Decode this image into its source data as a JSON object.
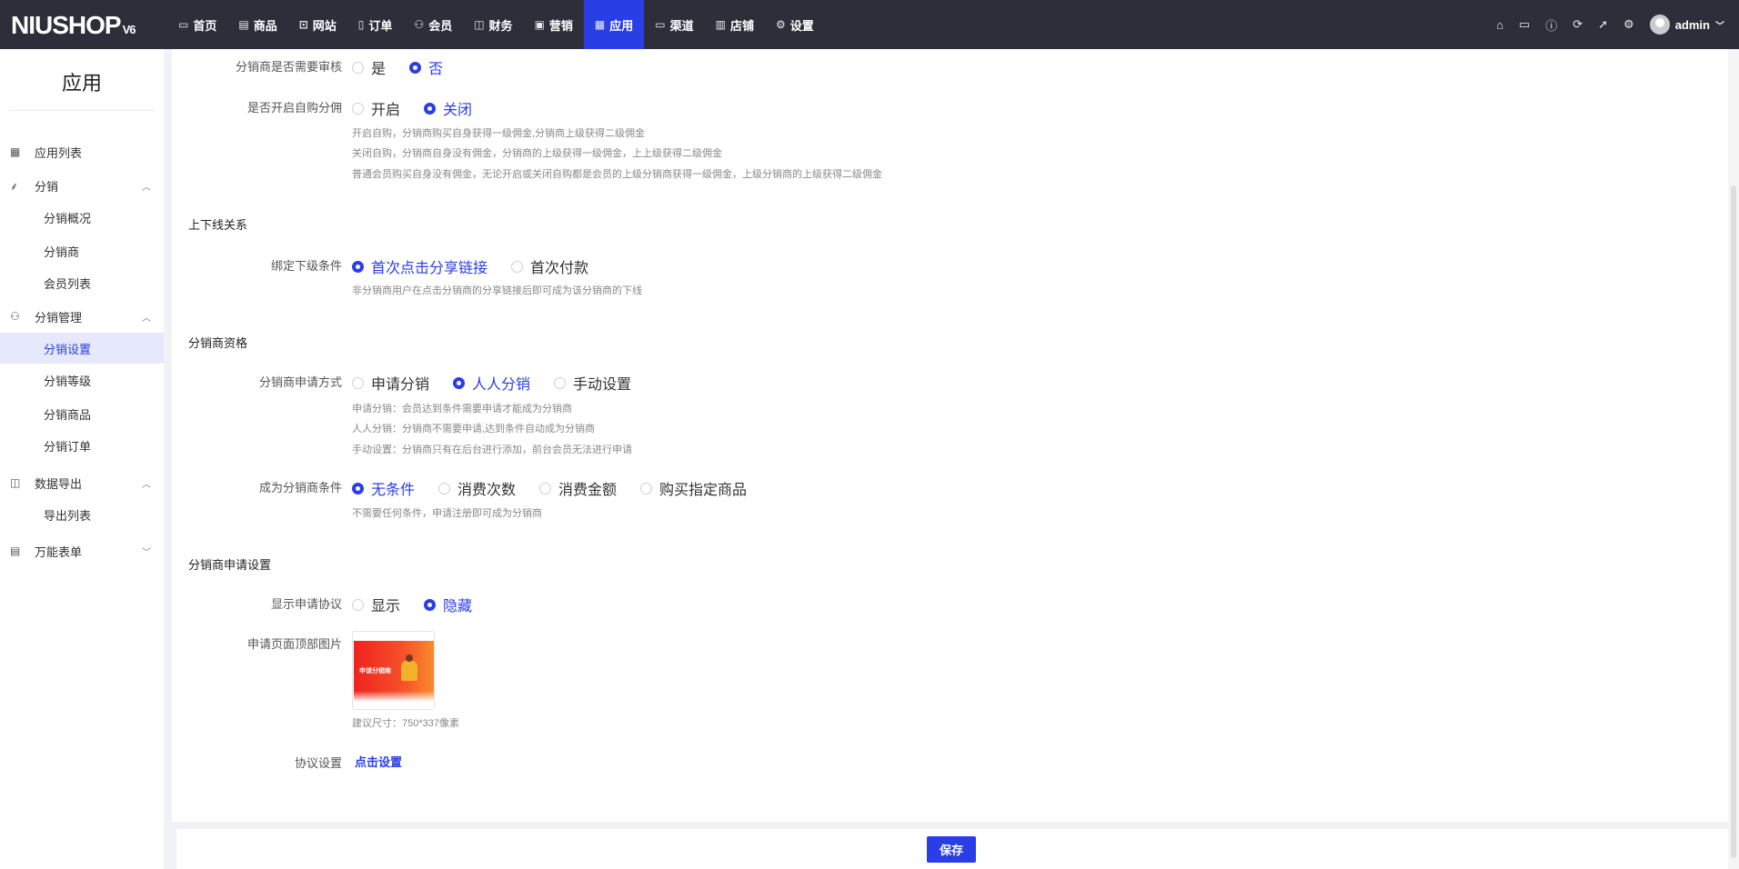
{
  "header": {
    "logo": "NIUSHOP",
    "logo_version": "V6",
    "nav": [
      {
        "label": "首页",
        "icon": "monitor-icon"
      },
      {
        "label": "商品",
        "icon": "goods-icon"
      },
      {
        "label": "网站",
        "icon": "website-icon"
      },
      {
        "label": "订单",
        "icon": "order-icon"
      },
      {
        "label": "会员",
        "icon": "member-icon"
      },
      {
        "label": "财务",
        "icon": "finance-icon"
      },
      {
        "label": "营销",
        "icon": "marketing-icon"
      },
      {
        "label": "应用",
        "icon": "app-icon",
        "active": true
      },
      {
        "label": "渠道",
        "icon": "channel-icon"
      },
      {
        "label": "店铺",
        "icon": "store-icon"
      },
      {
        "label": "设置",
        "icon": "settings-icon"
      }
    ],
    "user": "admin"
  },
  "sidebar": {
    "title": "应用",
    "items": [
      {
        "label": "应用列表",
        "icon": "app-list-icon"
      },
      {
        "label": "分销",
        "icon": "distribution-icon",
        "expanded": true
      },
      {
        "label": "分销概况"
      },
      {
        "label": "分销商"
      },
      {
        "label": "会员列表"
      },
      {
        "label": "分销管理",
        "icon": "manage-icon",
        "expanded": true
      },
      {
        "label": "分销设置",
        "active": true
      },
      {
        "label": "分销等级"
      },
      {
        "label": "分销商品"
      },
      {
        "label": "分销订单"
      },
      {
        "label": "数据导出",
        "icon": "export-icon",
        "expanded": true
      },
      {
        "label": "导出列表"
      },
      {
        "label": "万能表单",
        "icon": "form-icon",
        "expanded": false
      }
    ]
  },
  "form": {
    "audit": {
      "label": "分销商是否需要审核",
      "options": [
        "是",
        "否"
      ],
      "selected": 1
    },
    "self_buy": {
      "label": "是否开启自购分佣",
      "options": [
        "开启",
        "关闭"
      ],
      "selected": 1,
      "hints": [
        "开启自购，分销商购买自身获得一级佣金,分销商上级获得二级佣金",
        "关闭自购，分销商自身没有佣金，分销商的上级获得一级佣金，上上级获得二级佣金",
        "普通会员购买自身没有佣金，无论开启或关闭自购都是会员的上级分销商获得一级佣金，上级分销商的上级获得二级佣金"
      ]
    },
    "section_relation": "上下线关系",
    "bind": {
      "label": "绑定下级条件",
      "options": [
        "首次点击分享链接",
        "首次付款"
      ],
      "selected": 0,
      "hint": "非分销商用户在点击分销商的分享链接后即可成为该分销商的下线"
    },
    "section_qualification": "分销商资格",
    "apply_mode": {
      "label": "分销商申请方式",
      "options": [
        "申请分销",
        "人人分销",
        "手动设置"
      ],
      "selected": 1,
      "hints": [
        "申请分销：会员达到条件需要申请才能成为分销商",
        "人人分销：分销商不需要申请,达到条件自动成为分销商",
        "手动设置：分销商只有在后台进行添加，前台会员无法进行申请"
      ]
    },
    "condition": {
      "label": "成为分销商条件",
      "options": [
        "无条件",
        "消费次数",
        "消费金额",
        "购买指定商品"
      ],
      "selected": 0,
      "hint": "不需要任何条件，申请注册即可成为分销商"
    },
    "section_apply": "分销商申请设置",
    "show_agreement": {
      "label": "显示申请协议",
      "options": [
        "显示",
        "隐藏"
      ],
      "selected": 1
    },
    "top_image": {
      "label": "申请页面顶部图片",
      "banner_text": "申请分销商",
      "hint": "建议尺寸：750*337像素"
    },
    "agreement": {
      "label": "协议设置",
      "link": "点击设置"
    }
  },
  "footer": {
    "save": "保存"
  }
}
